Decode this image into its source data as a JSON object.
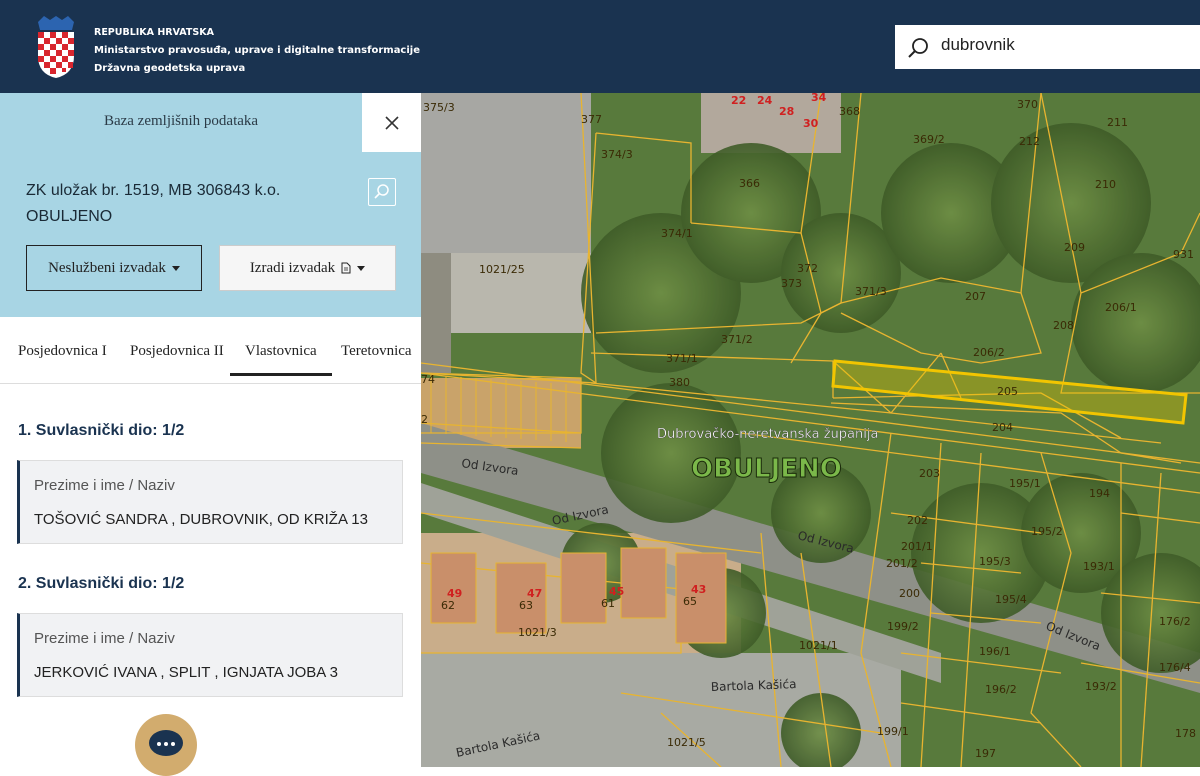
{
  "header": {
    "org_line1": "REPUBLIKA HRVATSKA",
    "org_line2": "Ministarstvo pravosuđa, uprave i digitalne transformacije",
    "org_line3": "Državna geodetska uprava",
    "search_value": "dubrovnik",
    "colors": {
      "header_bg": "#1a3350"
    }
  },
  "panel": {
    "database_label": "Baza zemljišnih podataka",
    "title_line1": "ZK uložak br. 1519, MB 306843 k.o.",
    "title_line2": "OBULJENO",
    "btn_unofficial": "Neslužbeni izvadak",
    "btn_create": "Izradi izvadak",
    "tabs": [
      {
        "label": "Posjedovnica I",
        "active": false
      },
      {
        "label": "Posjedovnica II",
        "active": false
      },
      {
        "label": "Vlastovnica",
        "active": true
      },
      {
        "label": "Teretovnica",
        "active": false
      }
    ],
    "shares": [
      {
        "title": "1. Suvlasnički dio: 1/2",
        "field_label": "Prezime i ime / Naziv",
        "owner": "TOŠOVIĆ SANDRA , DUBROVNIK, OD KRIŽA 13"
      },
      {
        "title": "2. Suvlasnički dio: 1/2",
        "field_label": "Prezime i ime / Naziv",
        "owner": "JERKOVIĆ IVANA , SPLIT , IGNJATA JOBA 3"
      }
    ],
    "colors": {
      "info_bg": "#a8d5e4",
      "chat_bg": "#d2ac6e"
    }
  },
  "map": {
    "county_label": "Dubrovačko-neretvanska županija",
    "cadastral_label": "OBULJENO",
    "streets": [
      "Od Izvora",
      "Od Izvora",
      "Od Izvora",
      "Od Izvora",
      "Bartola Kašića",
      "Bartola Kašića"
    ],
    "parcel_numbers": [
      "375/3",
      "377",
      "374/3",
      "368",
      "366",
      "369/2",
      "370",
      "212",
      "211",
      "210",
      "209",
      "931",
      "374/1",
      "372",
      "373",
      "371/3",
      "207",
      "206/1",
      "208",
      "1021/25",
      "371/2",
      "371/1",
      "206/2",
      "380",
      "205",
      "204",
      "203",
      "195/1",
      "194",
      "202",
      "201/1",
      "201/2",
      "195/2",
      "195/3",
      "193/1",
      "200",
      "195/4",
      "199/2",
      "1021/1",
      "196/1",
      "196/2",
      "193/2",
      "176/2",
      "176/4",
      "1021/3",
      "199/1",
      "197",
      "178",
      "1021/5",
      "74",
      "2"
    ],
    "house_numbers": [
      "22",
      "24",
      "28",
      "30",
      "34",
      "49",
      "47",
      "45",
      "43"
    ],
    "house_minor": [
      "62",
      "63",
      "61",
      "65"
    ],
    "highlight_parcel": "205",
    "colors": {
      "parcel_line": "#e8b430",
      "highlight": "#f2c500"
    }
  }
}
